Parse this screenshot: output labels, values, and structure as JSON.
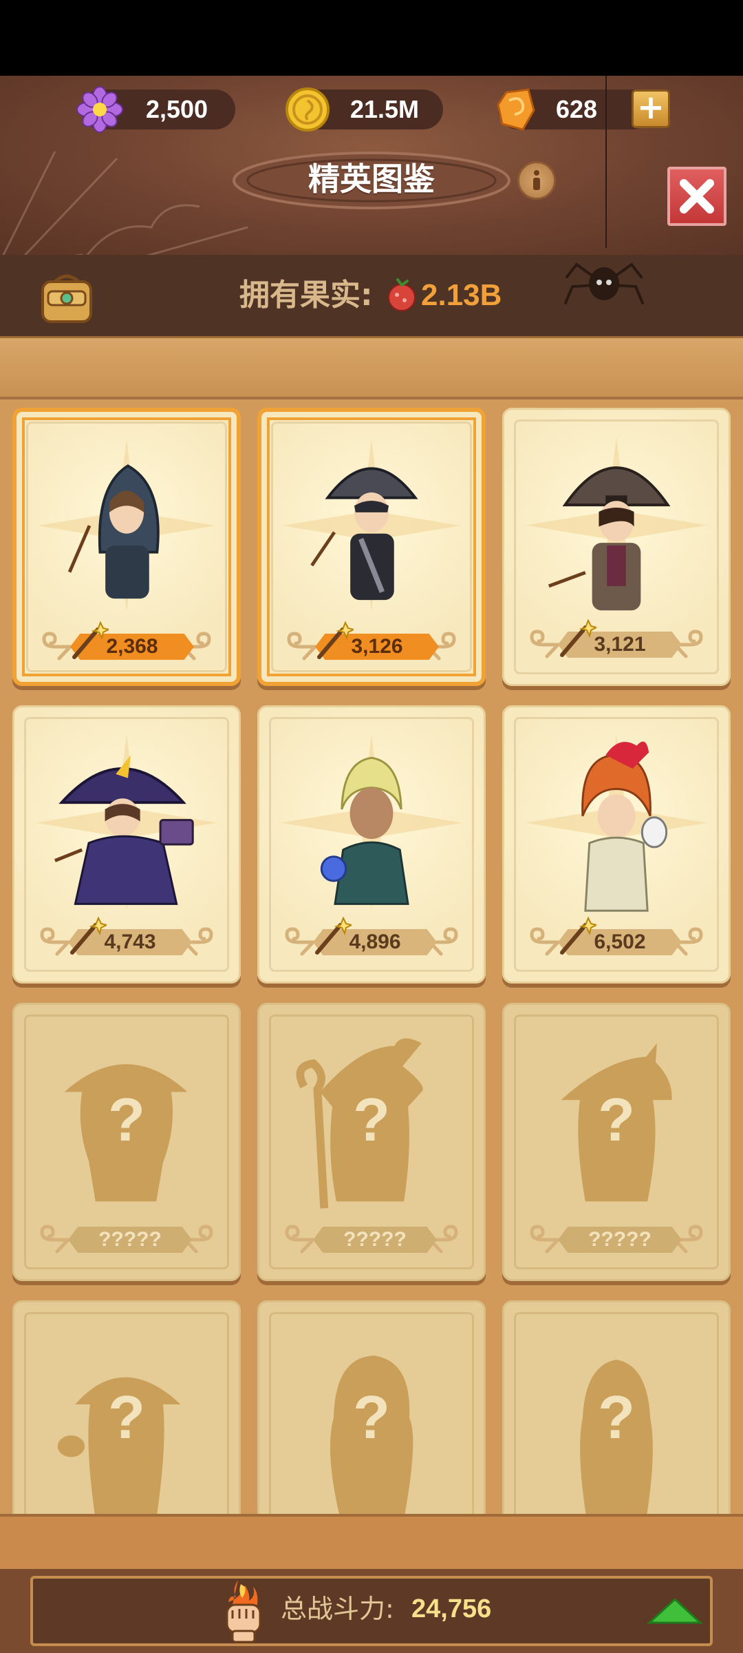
{
  "resources": {
    "gems": {
      "value": "2,500",
      "icon": "purple-flower-icon"
    },
    "coins": {
      "value": "21.5M",
      "icon": "gold-coin-icon"
    },
    "crystals": {
      "value": "628",
      "icon": "orange-crystal-icon"
    }
  },
  "header": {
    "title": "精英图鉴"
  },
  "fruit_bar": {
    "label": "拥有果实:",
    "value": "2.13B"
  },
  "cards": [
    {
      "power": "2,368",
      "state": "owned",
      "highlight": true
    },
    {
      "power": "3,126",
      "state": "owned",
      "highlight": true
    },
    {
      "power": "3,121",
      "state": "owned",
      "highlight": false
    },
    {
      "power": "4,743",
      "state": "owned",
      "highlight": false
    },
    {
      "power": "4,896",
      "state": "owned",
      "highlight": false
    },
    {
      "power": "6,502",
      "state": "owned",
      "highlight": false
    },
    {
      "power": "?????",
      "state": "locked",
      "highlight": false
    },
    {
      "power": "?????",
      "state": "locked",
      "highlight": false
    },
    {
      "power": "?????",
      "state": "locked",
      "highlight": false
    },
    {
      "power": "",
      "state": "locked",
      "highlight": false
    },
    {
      "power": "",
      "state": "locked",
      "highlight": false
    },
    {
      "power": "",
      "state": "locked",
      "highlight": false
    }
  ],
  "footer": {
    "label": "总战斗力:",
    "value": "24,756"
  },
  "colors": {
    "accent_orange": "#f08e22",
    "close_red": "#d94a4a",
    "up_green": "#3fbf3a"
  }
}
